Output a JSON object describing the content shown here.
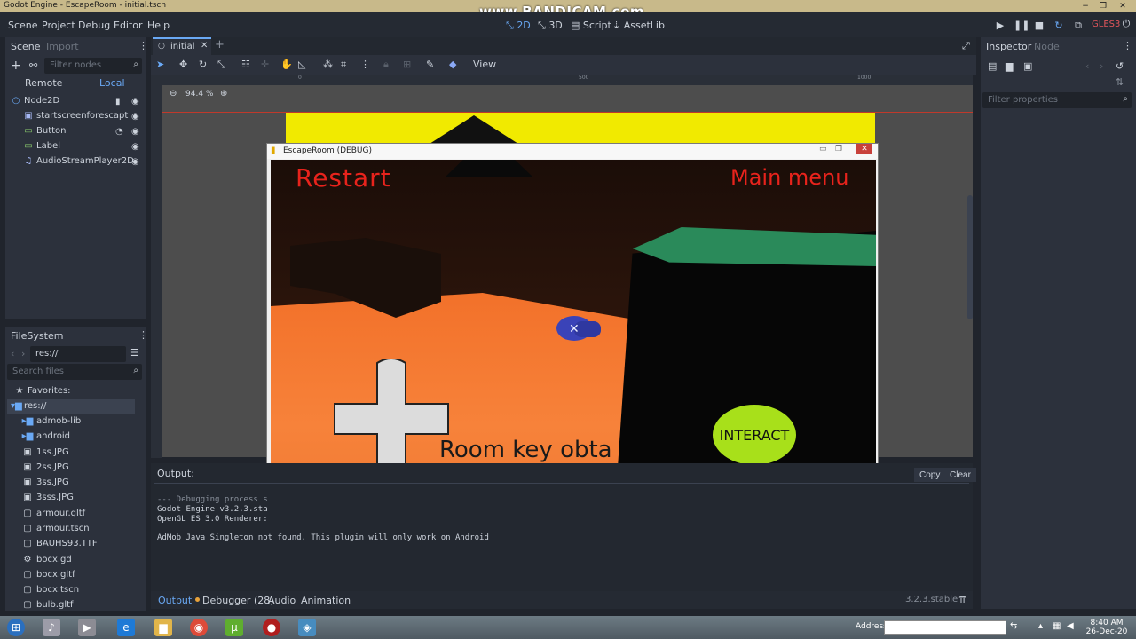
{
  "os": {
    "window_title": "Godot Engine - EscapeRoom - initial.tscn",
    "watermark": "www.BANDICAM.com",
    "minimize": "−",
    "maximize": "❐",
    "close": "✕"
  },
  "menubar": {
    "items": [
      "Scene",
      "Project",
      "Debug",
      "Editor",
      "Help"
    ],
    "workspaces": [
      "2D",
      "3D",
      "Script",
      "AssetLib"
    ],
    "renderer": "GLES3"
  },
  "scene_dock": {
    "tabs": [
      "Scene",
      "Import"
    ],
    "filter_placeholder": "Filter nodes",
    "remote_label": "Remote",
    "local_label": "Local",
    "nodes": [
      {
        "name": "Node2D",
        "icon": "node2d-icon"
      },
      {
        "name": "startscreenforescapt",
        "icon": "sprite-icon"
      },
      {
        "name": "Button",
        "icon": "button-icon"
      },
      {
        "name": "Label",
        "icon": "label-icon"
      },
      {
        "name": "AudioStreamPlayer2D",
        "icon": "audio-icon"
      }
    ]
  },
  "filesystem": {
    "title": "FileSystem",
    "path": "res://",
    "search_placeholder": "Search files",
    "favorites_label": "Favorites:",
    "root_label": "res://",
    "folders": [
      "admob-lib",
      "android"
    ],
    "files": [
      "1ss.JPG",
      "2ss.JPG",
      "3ss.JPG",
      "3sss.JPG",
      "armour.gltf",
      "armour.tscn",
      "BAUHS93.TTF",
      "bocx.gd",
      "bocx.gltf",
      "bocx.tscn",
      "bulb.gltf"
    ]
  },
  "editor": {
    "scene_tab": "initial",
    "zoom": "94.4 %",
    "view_menu": "View",
    "ruler_marks": [
      "0",
      "500",
      "1000"
    ]
  },
  "game": {
    "window_title": "EscapeRoom (DEBUG)",
    "restart_label": "Restart",
    "main_menu_label": "Main menu",
    "message": "Room key obta",
    "interact_label": "INTERACT"
  },
  "output": {
    "title": "Output:",
    "copy_label": "Copy",
    "clear_label": "Clear",
    "lines": [
      "--- Debugging process s",
      "Godot Engine v3.2.3.sta",
      "OpenGL ES 3.0 Renderer:",
      "AdMob Java Singleton not found. This plugin will only work on Android"
    ]
  },
  "bottom_tabs": [
    "Output",
    "Debugger (28)",
    "Audio",
    "Animation"
  ],
  "version": "3.2.3.stable",
  "inspector": {
    "tabs": [
      "Inspector",
      "Node"
    ],
    "filter_placeholder": "Filter properties"
  },
  "taskbar": {
    "address_label": "Address",
    "time": "8:40 AM",
    "date": "26-Dec-20"
  },
  "colors": {
    "accent": "#6aa9f5",
    "game_red": "#e8231c",
    "interact_green": "#a8e01a",
    "yellow_band": "#f1ea00"
  }
}
